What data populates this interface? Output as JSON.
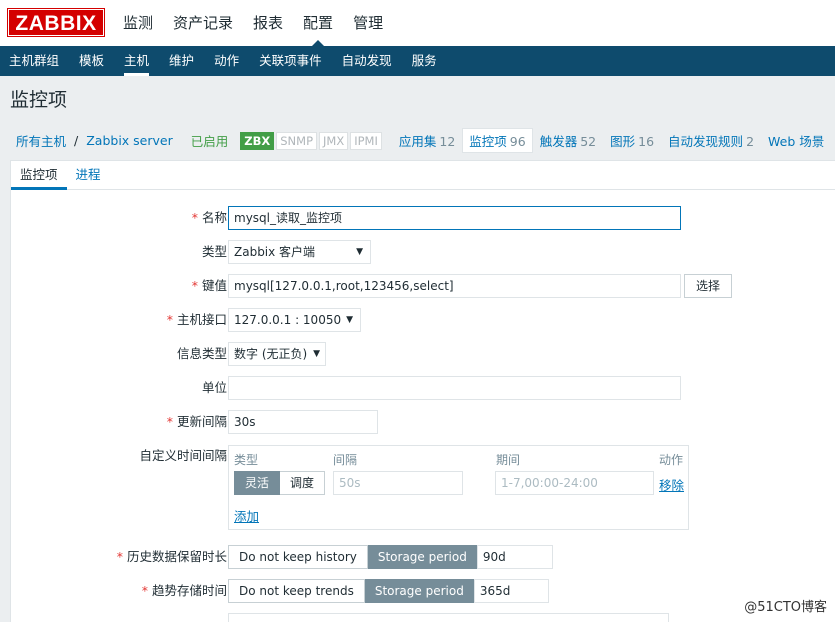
{
  "logo": "ZABBIX",
  "main_menu": [
    "监测",
    "资产记录",
    "报表",
    "配置",
    "管理"
  ],
  "sub_menu": [
    "主机群组",
    "模板",
    "主机",
    "维护",
    "动作",
    "关联项事件",
    "自动发现",
    "服务"
  ],
  "page_title": "监控项",
  "host_nav": {
    "all_hosts": "所有主机",
    "separator": "/",
    "host": "Zabbix server",
    "status": "已启用",
    "badges": [
      "ZBX",
      "SNMP",
      "JMX",
      "IPMI"
    ],
    "tabs": [
      {
        "label": "应用集",
        "count": "12"
      },
      {
        "label": "监控项",
        "count": "96"
      },
      {
        "label": "触发器",
        "count": "52"
      },
      {
        "label": "图形",
        "count": "16"
      },
      {
        "label": "自动发现规则",
        "count": "2"
      },
      {
        "label": "Web 场景",
        "count": ""
      }
    ]
  },
  "form_tabs": [
    "监控项",
    "进程"
  ],
  "form": {
    "name_label": "名称",
    "name_value": "mysql_读取_监控项",
    "type_label": "类型",
    "type_value": "Zabbix 客户端",
    "key_label": "键值",
    "key_value": "mysql[127.0.0.1,root,123456,select]",
    "select_button": "选择",
    "interface_label": "主机接口",
    "interface_value": "127.0.0.1 : 10050",
    "info_type_label": "信息类型",
    "info_type_value": "数字 (无正负)",
    "units_label": "单位",
    "units_value": "",
    "interval_label": "更新间隔",
    "interval_value": "30s",
    "custom_label": "自定义时间间隔",
    "custom": {
      "col_type": "类型",
      "col_interval": "间隔",
      "col_period": "期间",
      "col_action": "动作",
      "flexible": "灵活",
      "scheduling": "调度",
      "interval_placeholder": "50s",
      "period_placeholder": "1-7,00:00-24:00",
      "remove": "移除",
      "add": "添加"
    },
    "history_label": "历史数据保留时长",
    "history_no_keep": "Do not keep history",
    "history_storage": "Storage period",
    "history_value": "90d",
    "trends_label": "趋势存储时间",
    "trends_no_keep": "Do not keep trends",
    "trends_storage": "Storage period",
    "trends_value": "365d"
  },
  "watermark": "@51CTO博客",
  "colors": {
    "brand": "#d40000",
    "nav": "#0e4b6d",
    "link": "#0275b8",
    "enabled": "#429e47",
    "required": "#e33734",
    "segment_active": "#768d99"
  }
}
